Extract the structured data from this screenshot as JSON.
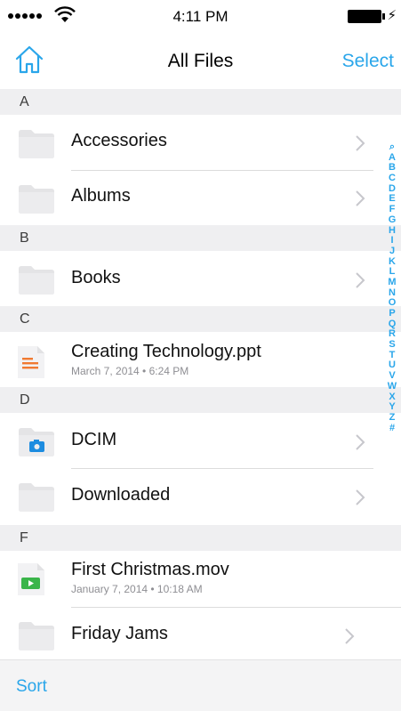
{
  "status_bar": {
    "time": "4:11 PM",
    "bolt": "⚡"
  },
  "nav": {
    "title": "All Files",
    "select_label": "Select"
  },
  "sections": [
    {
      "letter": "A"
    },
    {
      "letter": "B"
    },
    {
      "letter": "C"
    },
    {
      "letter": "D"
    },
    {
      "letter": "F"
    }
  ],
  "items": [
    {
      "name": "Accessories",
      "type": "folder"
    },
    {
      "name": "Albums",
      "type": "folder"
    },
    {
      "name": "Books",
      "type": "folder"
    },
    {
      "name": "Creating Technology.ppt",
      "type": "ppt",
      "date": "March 7, 2014 • 6:24 PM"
    },
    {
      "name": "DCIM",
      "type": "camera-folder"
    },
    {
      "name": "Downloaded",
      "type": "folder"
    },
    {
      "name": "First Christmas.mov",
      "type": "movie",
      "date": "January 7, 2014 • 10:18 AM"
    },
    {
      "name": "Friday Jams",
      "type": "folder"
    }
  ],
  "index": [
    "⌕",
    "A",
    "B",
    "C",
    "D",
    "E",
    "F",
    "G",
    "H",
    "I",
    "J",
    "K",
    "L",
    "M",
    "N",
    "O",
    "P",
    "Q",
    "R",
    "S",
    "T",
    "U",
    "V",
    "W",
    "X",
    "Y",
    "Z",
    "#"
  ],
  "toolbar": {
    "sort_label": "Sort"
  },
  "colors": {
    "accent": "#2aa6ea",
    "section_bg": "#efeff1",
    "ppt": "#f07a32",
    "movie": "#3ab54a"
  }
}
